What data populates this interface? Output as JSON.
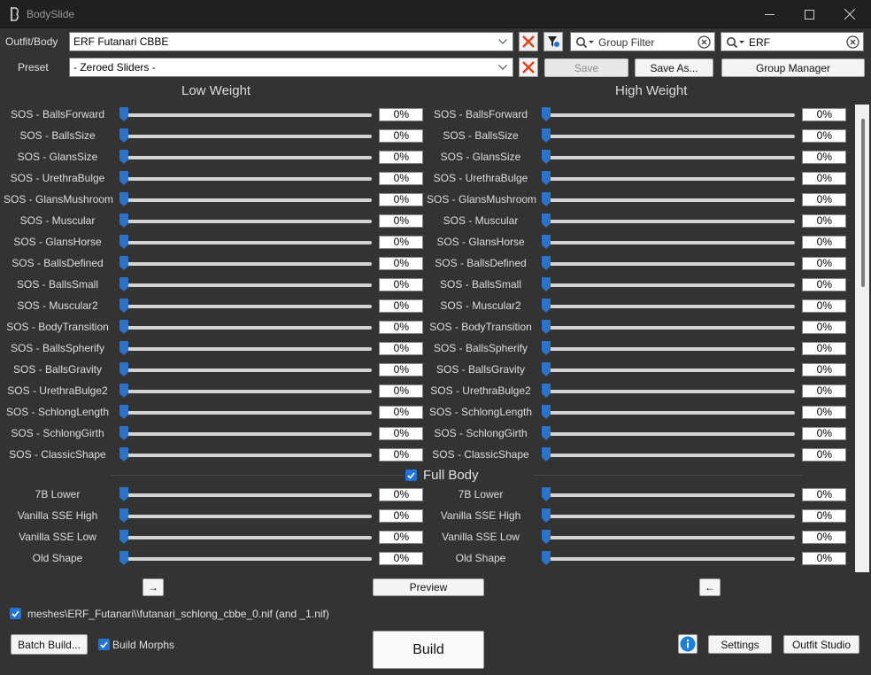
{
  "window": {
    "title": "BodySlide"
  },
  "top": {
    "outfit_label": "Outfit/Body",
    "outfit_value": "ERF Futanari CBBE",
    "preset_label": "Preset",
    "preset_value": "- Zeroed Sliders -",
    "group_filter_placeholder": "Group Filter",
    "outfit_filter_value": "ERF",
    "save_label": "Save",
    "save_as_label": "Save As...",
    "group_manager_label": "Group Manager"
  },
  "headers": {
    "low": "Low Weight",
    "high": "High Weight"
  },
  "sliders": [
    {
      "name": "SOS - BallsForward",
      "low": "0%",
      "high": "0%"
    },
    {
      "name": "SOS - BallsSize",
      "low": "0%",
      "high": "0%"
    },
    {
      "name": "SOS - GlansSize",
      "low": "0%",
      "high": "0%"
    },
    {
      "name": "SOS - UrethraBulge",
      "low": "0%",
      "high": "0%"
    },
    {
      "name": "SOS - GlansMushroom",
      "low": "0%",
      "high": "0%"
    },
    {
      "name": "SOS - Muscular",
      "low": "0%",
      "high": "0%"
    },
    {
      "name": "SOS - GlansHorse",
      "low": "0%",
      "high": "0%"
    },
    {
      "name": "SOS - BallsDefined",
      "low": "0%",
      "high": "0%"
    },
    {
      "name": "SOS - BallsSmall",
      "low": "0%",
      "high": "0%"
    },
    {
      "name": "SOS - Muscular2",
      "low": "0%",
      "high": "0%"
    },
    {
      "name": "SOS - BodyTransition",
      "low": "0%",
      "high": "0%"
    },
    {
      "name": "SOS - BallsSpherify",
      "low": "0%",
      "high": "0%"
    },
    {
      "name": "SOS - BallsGravity",
      "low": "0%",
      "high": "0%"
    },
    {
      "name": "SOS - UrethraBulge2",
      "low": "0%",
      "high": "0%"
    },
    {
      "name": "SOS - SchlongLength",
      "low": "0%",
      "high": "0%"
    },
    {
      "name": "SOS - SchlongGirth",
      "low": "0%",
      "high": "0%"
    },
    {
      "name": "SOS - ClassicShape",
      "low": "0%",
      "high": "0%"
    }
  ],
  "fullbody": {
    "label": "Full Body",
    "checked": true,
    "sliders": [
      {
        "name": "7B Lower",
        "low": "0%",
        "high": "0%"
      },
      {
        "name": "Vanilla SSE High",
        "low": "0%",
        "high": "0%"
      },
      {
        "name": "Vanilla SSE Low",
        "low": "0%",
        "high": "0%"
      },
      {
        "name": "Old Shape",
        "low": "0%",
        "high": "0%"
      }
    ]
  },
  "bottom": {
    "copy_right_glyph": "→",
    "copy_left_glyph": "←",
    "preview_label": "Preview",
    "output_path": "meshes\\ERF_Futanari\\\\futanari_schlong_cbbe_0.nif (and _1.nif)",
    "output_checked": true,
    "batch_build_label": "Batch Build...",
    "build_morphs_label": "Build Morphs",
    "build_morphs_checked": true,
    "build_label": "Build",
    "settings_label": "Settings",
    "outfit_studio_label": "Outfit Studio"
  },
  "colors": {
    "accent": "#2173d6",
    "thumb": "#2a73c8",
    "background": "#333333",
    "clear_x": "#e0431b",
    "info": "#1a7fd6"
  }
}
